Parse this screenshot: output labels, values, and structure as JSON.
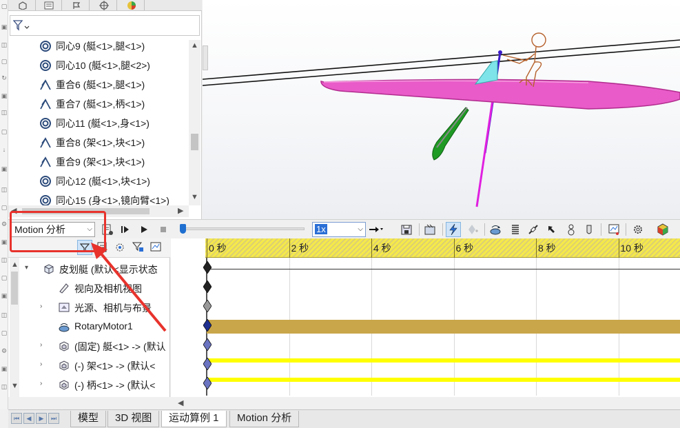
{
  "tree": {
    "mates": [
      {
        "type": "concentric",
        "label": "同心9 (艇<1>,腿<1>)"
      },
      {
        "type": "concentric",
        "label": "同心10 (艇<1>,腿<2>)"
      },
      {
        "type": "coincident",
        "label": "重合6 (艇<1>,腿<1>)"
      },
      {
        "type": "coincident",
        "label": "重合7 (艇<1>,柄<1>)"
      },
      {
        "type": "concentric",
        "label": "同心11 (艇<1>,身<1>)"
      },
      {
        "type": "coincident",
        "label": "重合8 (架<1>,块<1>)"
      },
      {
        "type": "coincident",
        "label": "重合9 (架<1>,块<1>)"
      },
      {
        "type": "concentric",
        "label": "同心12 (艇<1>,块<1>)"
      },
      {
        "type": "concentric",
        "label": "同心15 (身<1>,镜向臂<1>)"
      }
    ]
  },
  "toolbar": {
    "study_type": "Motion 分析",
    "playback_speed": "1x",
    "time_position": 0
  },
  "motion_tree": {
    "items": [
      {
        "label": "皮划艇 (默认<显示状态",
        "icon": "assembly-icon",
        "expander": "▾"
      },
      {
        "label": "视向及相机视图",
        "icon": "camera-icon",
        "expander": ""
      },
      {
        "label": "光源、相机与布景",
        "icon": "lights-icon",
        "expander": "›"
      },
      {
        "label": "RotaryMotor1",
        "icon": "rotary-motor-icon",
        "expander": ""
      },
      {
        "label": "(固定) 艇<1> -> (默认",
        "icon": "part-icon",
        "expander": "›"
      },
      {
        "label": "(-) 架<1> -> (默认<",
        "icon": "part-icon",
        "expander": "›"
      },
      {
        "label": "(-) 柄<1> -> (默认<",
        "icon": "part-icon",
        "expander": "›"
      }
    ]
  },
  "timeline": {
    "tick_labels": [
      "0 秒",
      "2 秒",
      "4 秒",
      "6 秒",
      "8 秒",
      "10 秒"
    ],
    "colors": {
      "ruler": "#f5e94a",
      "motor_bar": "#c9a64a",
      "part_bar": "#ffff00",
      "highlight": "#e8322c"
    }
  },
  "bottom_tabs": [
    "模型",
    "3D 视图",
    "运动算例 1",
    "Motion 分析"
  ],
  "active_bottom_tab": "运动算例 1"
}
